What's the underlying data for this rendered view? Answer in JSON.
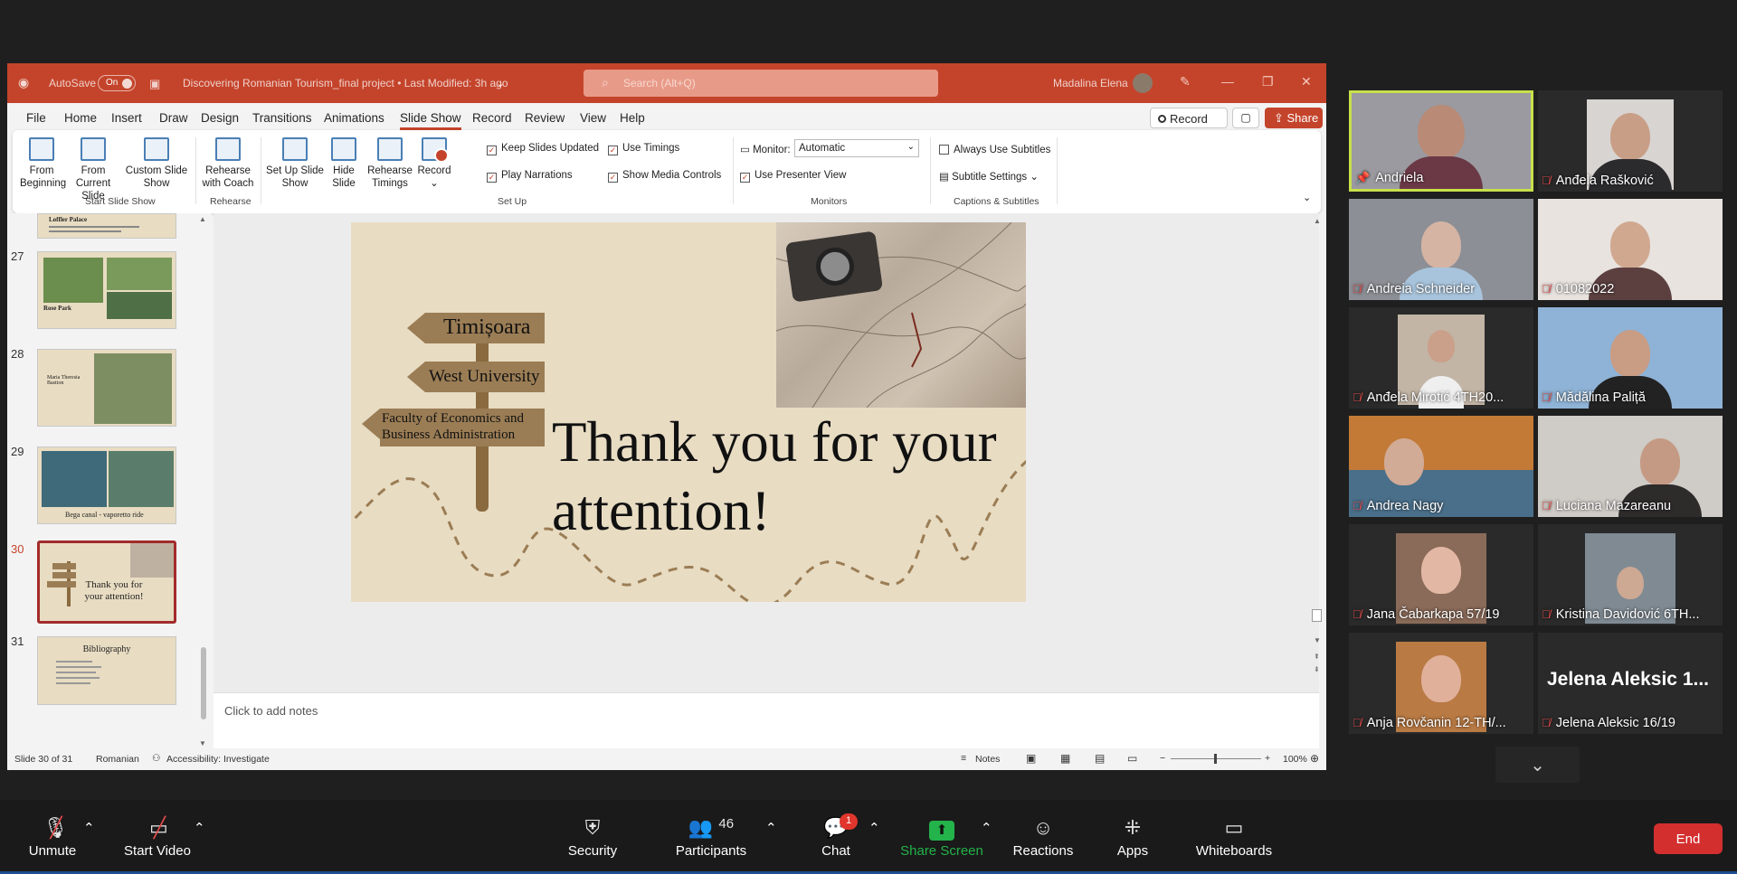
{
  "ppt": {
    "autosave_label": "AutoSave",
    "autosave_state": "On",
    "doc_title": "Discovering Romanian Tourism_final project • Last Modified: 3h ago",
    "search_placeholder": "Search (Alt+Q)",
    "user_name": "Madalina Elena",
    "menu": [
      "File",
      "Home",
      "Insert",
      "Draw",
      "Design",
      "Transitions",
      "Animations",
      "Slide Show",
      "Record",
      "Review",
      "View",
      "Help"
    ],
    "active_menu": "Slide Show",
    "record_label": "Record",
    "share_label": "Share",
    "ribbon": {
      "from_beginning": "From Beginning",
      "from_current": "From Current Slide",
      "custom_slide_show": "Custom Slide Show",
      "group_start": "Start Slide Show",
      "rehearse_coach": "Rehearse with Coach",
      "group_rehearse": "Rehearse",
      "setup_show": "Set Up Slide Show",
      "hide_slide": "Hide Slide",
      "rehearse_timings": "Rehearse Timings",
      "record": "Record",
      "keep_slides_updated": "Keep Slides Updated",
      "use_timings": "Use Timings",
      "play_narrations": "Play Narrations",
      "show_media_controls": "Show Media Controls",
      "group_setup": "Set Up",
      "monitor_label": "Monitor:",
      "monitor_value": "Automatic",
      "use_presenter_view": "Use Presenter View",
      "group_monitors": "Monitors",
      "always_use_subtitles": "Always Use Subtitles",
      "subtitle_settings": "Subtitle Settings",
      "group_captions": "Captions & Subtitles"
    },
    "thumbnails": [
      {
        "num": "27",
        "caption": "Rose Park"
      },
      {
        "num": "28",
        "caption": "Maria Theresia Bastion"
      },
      {
        "num": "29",
        "caption": "Bega canal - vaporetto ride"
      },
      {
        "num": "30",
        "caption": "Thank you for your attention!"
      },
      {
        "num": "31",
        "caption": "Bibliography"
      }
    ],
    "thumb26_caption": "Loffler Palace",
    "slide": {
      "sign1": "Timișoara",
      "sign2": "West University",
      "sign3": "Faculty of Economics and Business Administration",
      "title": "Thank you for your attention!"
    },
    "notes_placeholder": "Click to add notes",
    "status": {
      "slide_count": "Slide 30 of 31",
      "language": "Romanian",
      "accessibility": "Accessibility: Investigate",
      "notes": "Notes",
      "zoom": "100%"
    }
  },
  "participants": [
    {
      "name": "Andriela",
      "icon": "pin-icon",
      "muted": false
    },
    {
      "name": "Anđela Rašković",
      "muted": true
    },
    {
      "name": "Andreia Schneider",
      "muted": true
    },
    {
      "name": "01082022",
      "muted": true
    },
    {
      "name": "Anđela Mirotić 4TH20...",
      "muted": true
    },
    {
      "name": "Mădălina Paliță",
      "muted": true
    },
    {
      "name": "Andrea Nagy",
      "muted": true
    },
    {
      "name": "Luciana Mazareanu",
      "muted": true
    },
    {
      "name": "Jana Čabarkapa 57/19",
      "muted": true
    },
    {
      "name": "Kristina Davidović 6TH...",
      "muted": true
    },
    {
      "name": "Anja Rovčanin 12-TH/...",
      "muted": true
    },
    {
      "name": "Jelena Aleksic 16/19",
      "muted": true
    }
  ],
  "jelena_tile_text": "Jelena Aleksic 1...",
  "toolbar": {
    "unmute": "Unmute",
    "start_video": "Start Video",
    "security": "Security",
    "participants": "Participants",
    "participants_count": "46",
    "chat": "Chat",
    "chat_badge": "1",
    "share_screen": "Share Screen",
    "reactions": "Reactions",
    "apps": "Apps",
    "whiteboards": "Whiteboards",
    "end": "End"
  },
  "colors": {
    "ppt_accent": "#c4442b",
    "share_green": "#23b34a",
    "end_red": "#d32f2f",
    "active_speaker": "#c8e04a"
  }
}
